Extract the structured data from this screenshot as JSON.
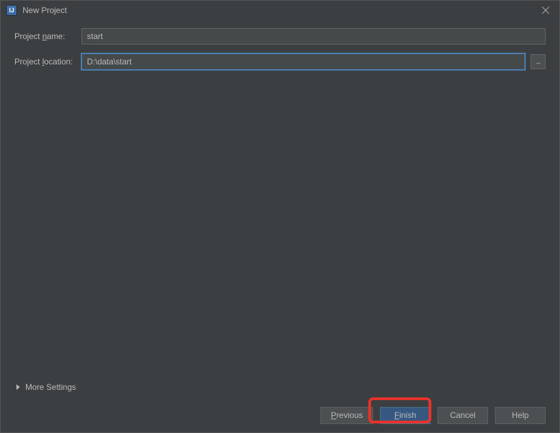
{
  "window": {
    "title": "New Project",
    "appIconText": "IJ"
  },
  "form": {
    "projectName": {
      "label_pre": "Project ",
      "label_u": "n",
      "label_post": "ame:",
      "value": "start"
    },
    "projectLocation": {
      "label_pre": "Project ",
      "label_u": "l",
      "label_post": "ocation:",
      "value": "D:\\data\\start"
    },
    "browseLabel": "..."
  },
  "moreSettings": {
    "label": "More Settings"
  },
  "buttons": {
    "previous_u": "P",
    "previous_post": "revious",
    "finish_u": "F",
    "finish_post": "inish",
    "cancel": "Cancel",
    "help": "Help"
  }
}
